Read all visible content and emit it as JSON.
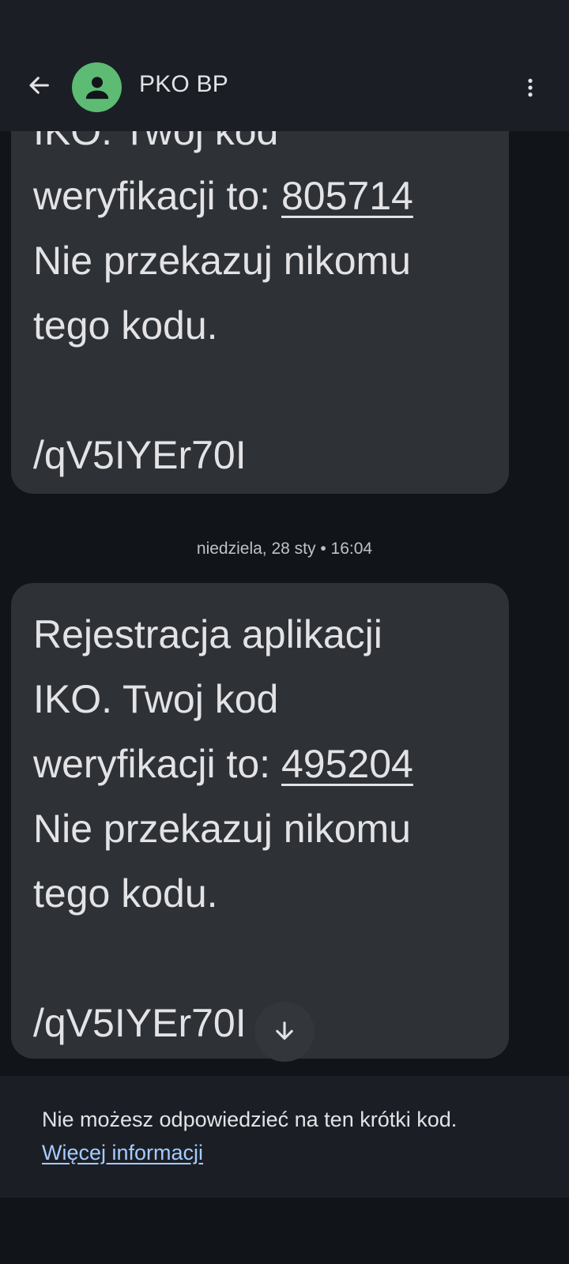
{
  "header": {
    "contact_name": "PKO BP",
    "back_icon": "arrow-left-icon",
    "avatar_icon": "person-icon",
    "avatar_color": "#5dbb73",
    "more_icon": "more-vert-icon"
  },
  "messages": [
    {
      "lines": [
        "IKO. Twoj kod",
        "weryfikacji to: ",
        "Nie przekazuj nikomu",
        "tego kodu.",
        "",
        "/qV5IYEr70I"
      ],
      "code": "805714"
    },
    {
      "lines": [
        "Rejestracja aplikacji",
        "IKO. Twoj kod",
        "weryfikacji to: ",
        "Nie przekazuj nikomu",
        "tego kodu.",
        "",
        "/qV5IYEr70I"
      ],
      "code": "495204"
    }
  ],
  "timestamp": "niedziela, 28 sty • 16:04",
  "scroll_down_icon": "arrow-down-icon",
  "footer": {
    "notice": "Nie możesz odpowiedzieć na ten krótki kod.",
    "link": "Więcej informacji",
    "link_color": "#a6cbff"
  }
}
